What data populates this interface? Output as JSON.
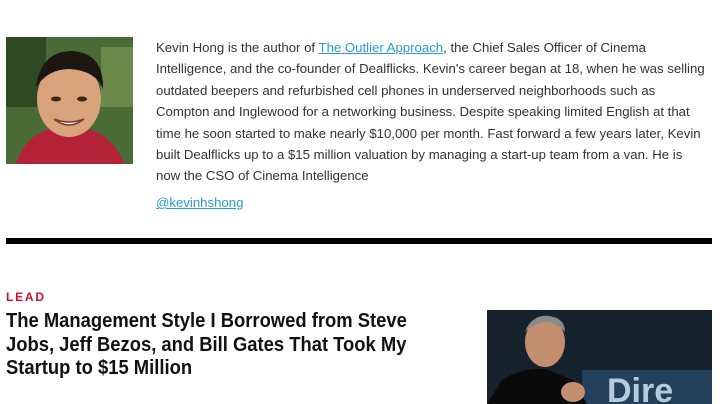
{
  "author": {
    "bio_before_link": "Kevin Hong is the author of ",
    "book_link": "The Outlier Approach",
    "bio_after_link": ", the Chief Sales Officer of Cinema Intelligence, and the co-founder of Dealflicks. Kevin's career began at 18, when he was selling outdated beepers and refurbished cell phones in underserved neighborhoods such as Compton and Inglewood for a networking business. Despite speaking limited English at that time he soon started to make nearly $10,000 per month. Fast forward a few years later, Kevin built Dealflicks up to a $15 million valuation by managing a start-up team from a van. He is now the CSO of Cinema Intelligence",
    "handle": "@kevinhshong"
  },
  "next_article": {
    "section": "LEAD",
    "headline": "The Management Style I Borrowed from Steve Jobs, Jeff Bezos, and Bill Gates That Took My Startup to $15 Million"
  },
  "colors": {
    "link": "#2a9ad4",
    "section_tag": "#c8102e",
    "rule": "#000000"
  }
}
